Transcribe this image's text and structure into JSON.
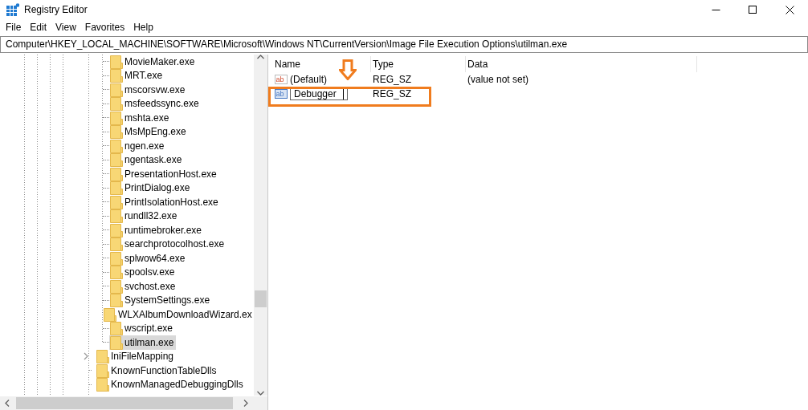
{
  "window": {
    "title": "Registry Editor"
  },
  "menu": [
    "File",
    "Edit",
    "View",
    "Favorites",
    "Help"
  ],
  "address": "Computer\\HKEY_LOCAL_MACHINE\\SOFTWARE\\Microsoft\\Windows NT\\CurrentVersion\\Image File Execution Options\\utilman.exe",
  "tree": {
    "items": [
      {
        "children": [
          {
            "label": "MovieMaker.exe",
            "selected": false
          },
          {
            "label": "MRT.exe",
            "selected": false
          },
          {
            "label": "mscorsvw.exe",
            "selected": false
          },
          {
            "label": "msfeedssync.exe",
            "selected": false
          },
          {
            "label": "mshta.exe",
            "selected": false
          },
          {
            "label": "MsMpEng.exe",
            "selected": false
          },
          {
            "label": "ngen.exe",
            "selected": false
          },
          {
            "label": "ngentask.exe",
            "selected": false
          },
          {
            "label": "PresentationHost.exe",
            "selected": false
          },
          {
            "label": "PrintDialog.exe",
            "selected": false
          },
          {
            "label": "PrintIsolationHost.exe",
            "selected": false
          },
          {
            "label": "rundll32.exe",
            "selected": false
          },
          {
            "label": "runtimebroker.exe",
            "selected": false
          },
          {
            "label": "searchprotocolhost.exe",
            "selected": false
          },
          {
            "label": "splwow64.exe",
            "selected": false
          },
          {
            "label": "spoolsv.exe",
            "selected": false
          },
          {
            "label": "svchost.exe",
            "selected": false
          },
          {
            "label": "SystemSettings.exe",
            "selected": false
          },
          {
            "label": "WLXAlbumDownloadWizard.ex",
            "selected": false
          },
          {
            "label": "wscript.exe",
            "selected": false
          },
          {
            "label": "utilman.exe",
            "selected": true
          }
        ]
      },
      {
        "label": "IniFileMapping",
        "selected": false,
        "kind": "branch",
        "expanded": false
      },
      {
        "label": "KnownFunctionTableDlls",
        "selected": false,
        "kind": "leaf"
      },
      {
        "label": "KnownManagedDebuggingDlls",
        "selected": false,
        "kind": "leaf"
      }
    ]
  },
  "values": {
    "columns": [
      "Name",
      "Type",
      "Data"
    ],
    "rows": [
      {
        "icon": "ab",
        "name": "(Default)",
        "type": "REG_SZ",
        "data": "(value not set)",
        "editing": false
      },
      {
        "icon": "ab",
        "name": "Debugger",
        "type": "REG_SZ",
        "editing": true
      }
    ]
  }
}
